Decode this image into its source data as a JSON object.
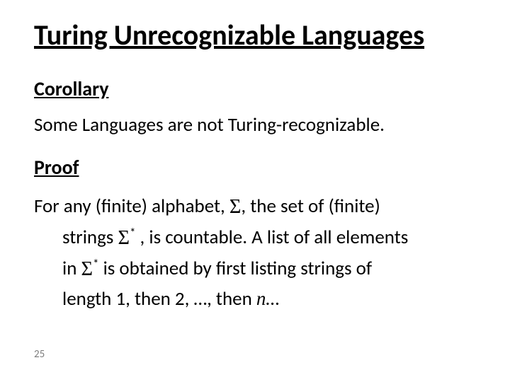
{
  "title": "Turing Unrecognizable Languages",
  "corollary_label": "Corollary",
  "corollary_text": "Some Languages are not Turing-recognizable.",
  "proof_label": "Proof",
  "proof": {
    "p1a": "For any (finite) alphabet, ",
    "sigma": "Σ",
    "p1b": ", the set of (finite)",
    "p2a": "strings ",
    "sigmastar1": "Σ",
    "star1": "*",
    "p2b": " , is countable. A list of all elements",
    "p3a": "in ",
    "sigmastar2": "Σ",
    "star2": "*",
    "p3b": " is obtained by first listing strings of",
    "p4a": "length 1, then 2, …, then ",
    "n": "n",
    "p4b": "…"
  },
  "page_number": "25"
}
